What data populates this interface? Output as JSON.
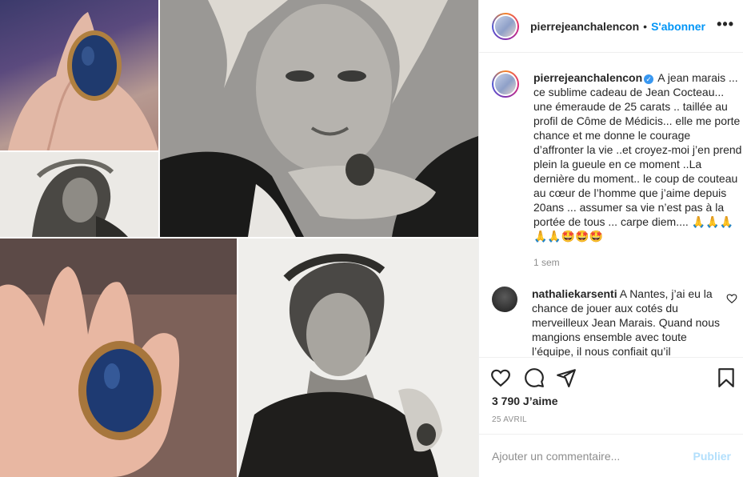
{
  "post": {
    "author": "pierrejeanchalencon",
    "separator": "•",
    "follow_label": "S'abonner",
    "more_label": "•••",
    "caption": "A jean marais ... ce sublime cadeau de Jean Cocteau... une émeraude de 25 carats .. taillée au profil de Côme de Médicis... elle me porte chance et me donne le courage d’affronter la vie ..et croyez-moi j’en prend plein la gueule en ce moment ..La dernière du moment.. le coup de couteau au cœur de l’homme que j’aime depuis 20ans ... assumer sa vie n’est pas à la portée de tous ... carpe diem.... 🙏🙏🙏🙏🙏🤩🤩🤩",
    "verified_mark": "✓",
    "time_ago": "1 sem",
    "likes": "3 790 J’aime",
    "date": "25 AVRIL"
  },
  "comments": [
    {
      "author": "nathaliekarsenti",
      "text": "A Nantes, j’ai eu la chance de jouer aux cotés du merveilleux Jean Marais. Quand nous mangions ensemble avec toute l’équipe, il nous confiait qu’il"
    }
  ],
  "composer": {
    "placeholder": "Ajouter un commentaire...",
    "publish_label": "Publier"
  },
  "icons": {
    "like": "heart-icon",
    "comment": "comment-icon",
    "share": "share-icon",
    "save": "bookmark-icon",
    "comment_like": "heart-icon",
    "options": "more-icon"
  },
  "colors": {
    "accent": "#0095f6",
    "publish_disabled": "#b2dffc",
    "secondary_text": "#8e8e8e",
    "verified": "#3897f0"
  }
}
